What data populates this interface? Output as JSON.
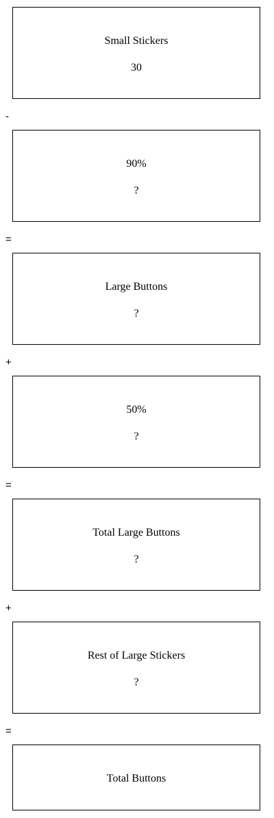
{
  "steps": [
    {
      "label": "Small Stickers",
      "value": "30"
    },
    {
      "label": "90%",
      "value": "?"
    },
    {
      "label": "Large Buttons",
      "value": "?"
    },
    {
      "label": "50%",
      "value": "?"
    },
    {
      "label": "Total Large Buttons",
      "value": "?"
    },
    {
      "label": "Rest of Large Stickers",
      "value": "?"
    }
  ],
  "final": {
    "label": "Total Buttons"
  },
  "operators": [
    "-",
    "=",
    "+",
    "=",
    "+",
    "="
  ]
}
